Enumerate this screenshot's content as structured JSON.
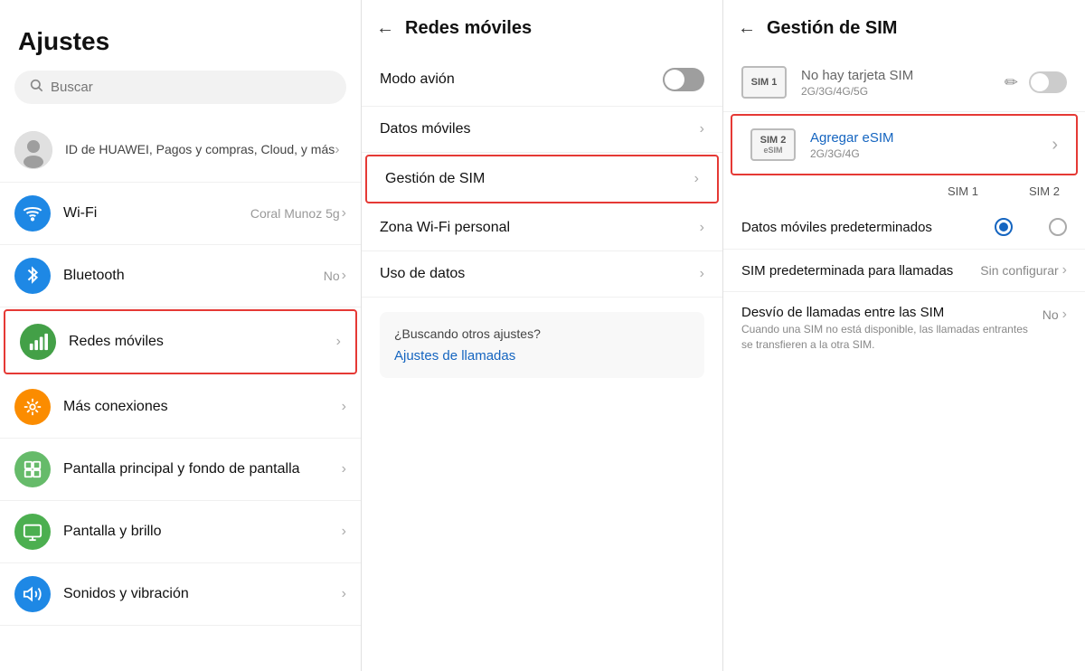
{
  "leftPanel": {
    "title": "Ajustes",
    "search": {
      "placeholder": "Buscar"
    },
    "profileItem": {
      "label": "ID de HUAWEI, Pagos y compras, Cloud, y más"
    },
    "menuItems": [
      {
        "id": "wifi",
        "label": "Wi-Fi",
        "value": "Coral Munoz 5g",
        "iconColor": "ic-wifi",
        "iconSymbol": "wifi"
      },
      {
        "id": "bluetooth",
        "label": "Bluetooth",
        "value": "No",
        "iconColor": "ic-bluetooth",
        "iconSymbol": "bluetooth"
      },
      {
        "id": "redes",
        "label": "Redes móviles",
        "value": "",
        "iconColor": "ic-network",
        "iconSymbol": "network",
        "highlighted": true
      },
      {
        "id": "mas",
        "label": "Más conexiones",
        "value": "",
        "iconColor": "ic-more",
        "iconSymbol": "more"
      },
      {
        "id": "pantalla-fondo",
        "label": "Pantalla principal y fondo de pantalla",
        "value": "",
        "iconColor": "ic-home",
        "iconSymbol": "home"
      },
      {
        "id": "pantalla-brillo",
        "label": "Pantalla y brillo",
        "value": "",
        "iconColor": "ic-display",
        "iconSymbol": "display"
      },
      {
        "id": "sonidos",
        "label": "Sonidos y vibración",
        "value": "",
        "iconColor": "ic-sound",
        "iconSymbol": "sound"
      }
    ]
  },
  "middlePanel": {
    "title": "Redes móviles",
    "backLabel": "←",
    "rows": [
      {
        "id": "modo-avion",
        "label": "Modo avión",
        "type": "toggle",
        "toggleOn": false
      },
      {
        "id": "datos-moviles",
        "label": "Datos móviles",
        "type": "chevron"
      },
      {
        "id": "gestion-sim",
        "label": "Gestión de SIM",
        "type": "chevron",
        "highlighted": true
      },
      {
        "id": "zona-wifi",
        "label": "Zona Wi-Fi personal",
        "type": "chevron"
      },
      {
        "id": "uso-datos",
        "label": "Uso de datos",
        "type": "chevron"
      }
    ],
    "suggestion": {
      "title": "¿Buscando otros ajustes?",
      "link": "Ajustes de llamadas"
    }
  },
  "rightPanel": {
    "title": "Gestión de SIM",
    "backLabel": "←",
    "sim1": {
      "slotLabel": "SIM 1",
      "statusText": "No hay tarjeta SIM",
      "techText": "2G/3G/4G/5G",
      "toggleOn": false
    },
    "sim2": {
      "slotLabel": "SIM 2",
      "slotSub": "eSIM",
      "name": "Agregar eSIM",
      "techText": "2G/3G/4G",
      "highlighted": true
    },
    "tableHeaders": {
      "sim1": "SIM 1",
      "sim2": "SIM 2"
    },
    "options": [
      {
        "id": "datos-pred",
        "label": "Datos móviles predeterminados",
        "type": "radio",
        "sim1Selected": true,
        "sim2Selected": false
      },
      {
        "id": "sim-llamadas",
        "label": "SIM predeterminada para llamadas",
        "type": "value",
        "value": "Sin configurar"
      }
    ],
    "desvio": {
      "title": "Desvío de llamadas entre las SIM",
      "sub": "Cuando una SIM no está disponible, las llamadas entrantes se transfieren a la otra SIM.",
      "value": "No"
    }
  }
}
